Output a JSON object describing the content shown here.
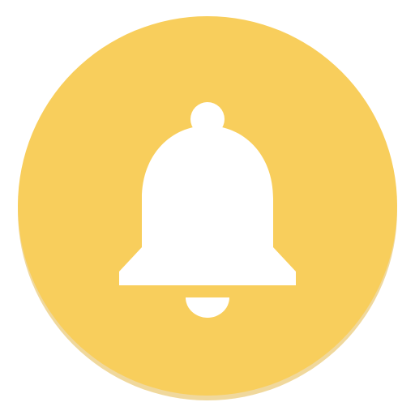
{
  "icon": {
    "name": "bell-icon",
    "background_color": "#F8CE5C",
    "shadow_color": "#E3B84A",
    "glyph_color": "#FFFFFF"
  }
}
